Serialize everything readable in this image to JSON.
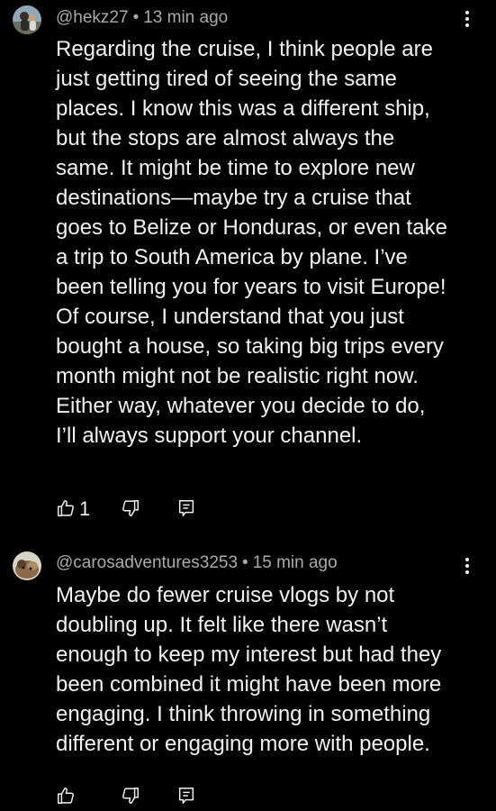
{
  "comments": [
    {
      "author": "@hekz27",
      "time": "13 min ago",
      "separator": "•",
      "text": "Regarding the cruise, I think people are\njust getting tired of seeing the same\nplaces. I know this was a different ship,\nbut the stops are almost always the\nsame. It might be time to explore new\ndestinations—maybe try a cruise that\ngoes to Belize or Honduras, or even take\na trip to South America by plane. I’ve\nbeen telling you for years to visit Europe!\nOf course, I understand that you just\nbought a house, so taking big trips every\nmonth might not be realistic right now.\nEither way, whatever you decide to do,\nI’ll always support your channel.",
      "like_count": "1",
      "avatar_icon": "person-avatar-icon"
    },
    {
      "author": "@carosadventures3253",
      "time": "15 min ago",
      "separator": "•",
      "text": "Maybe do fewer cruise vlogs by not\ndoubling up.  It felt like there wasn’t\nenough to keep my interest but had they\nbeen combined it might have been more\nengaging.  I think throwing in something\ndifferent or engaging more with people.",
      "like_count": "",
      "avatar_icon": "dog-avatar-icon"
    }
  ],
  "icons": {
    "like": "thumbs-up-icon",
    "dislike": "thumbs-down-icon",
    "reply": "reply-icon",
    "more": "more-vert-icon"
  },
  "colors": {
    "background": "#000000",
    "text": "#f1f1f1",
    "meta": "#aaaaaa"
  }
}
